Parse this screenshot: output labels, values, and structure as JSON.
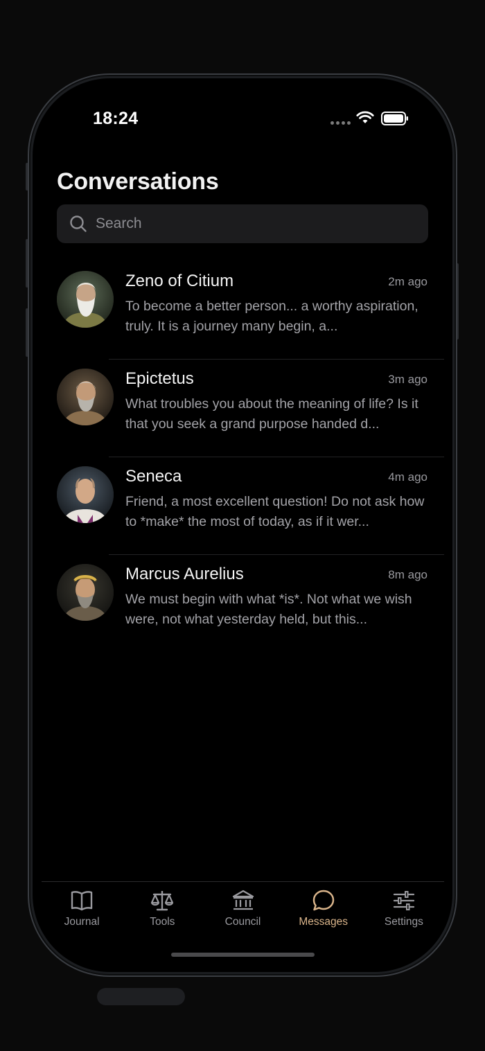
{
  "status_bar": {
    "time": "18:24"
  },
  "header": {
    "title": "Conversations"
  },
  "search": {
    "placeholder": "Search"
  },
  "conversations": [
    {
      "name": "Zeno of Citium",
      "time": "2m ago",
      "preview": "To become a better person... a worthy aspiration, truly. It is a journey many begin, a...",
      "avatar_icon": "zeno-portrait"
    },
    {
      "name": "Epictetus",
      "time": "3m ago",
      "preview": "What troubles you about the meaning of life? Is it that you seek a grand purpose handed d...",
      "avatar_icon": "epictetus-portrait"
    },
    {
      "name": "Seneca",
      "time": "4m ago",
      "preview": "Friend, a most excellent question! Do not ask how to *make* the most of today, as if it wer...",
      "avatar_icon": "seneca-portrait"
    },
    {
      "name": "Marcus Aurelius",
      "time": "8m ago",
      "preview": "We must begin with what *is*. Not what we wish were, not what yesterday held, but this...",
      "avatar_icon": "marcus-aurelius-portrait"
    }
  ],
  "tabs": [
    {
      "label": "Journal",
      "icon": "book-icon"
    },
    {
      "label": "Tools",
      "icon": "scale-icon"
    },
    {
      "label": "Council",
      "icon": "building-columns-icon"
    },
    {
      "label": "Messages",
      "icon": "chat-bubble-icon",
      "active": true
    },
    {
      "label": "Settings",
      "icon": "sliders-icon"
    }
  ],
  "colors": {
    "background": "#000000",
    "accent": "#d9b48a",
    "inactive_tab": "#9a9a9f",
    "search_bg": "#1c1c1e"
  }
}
